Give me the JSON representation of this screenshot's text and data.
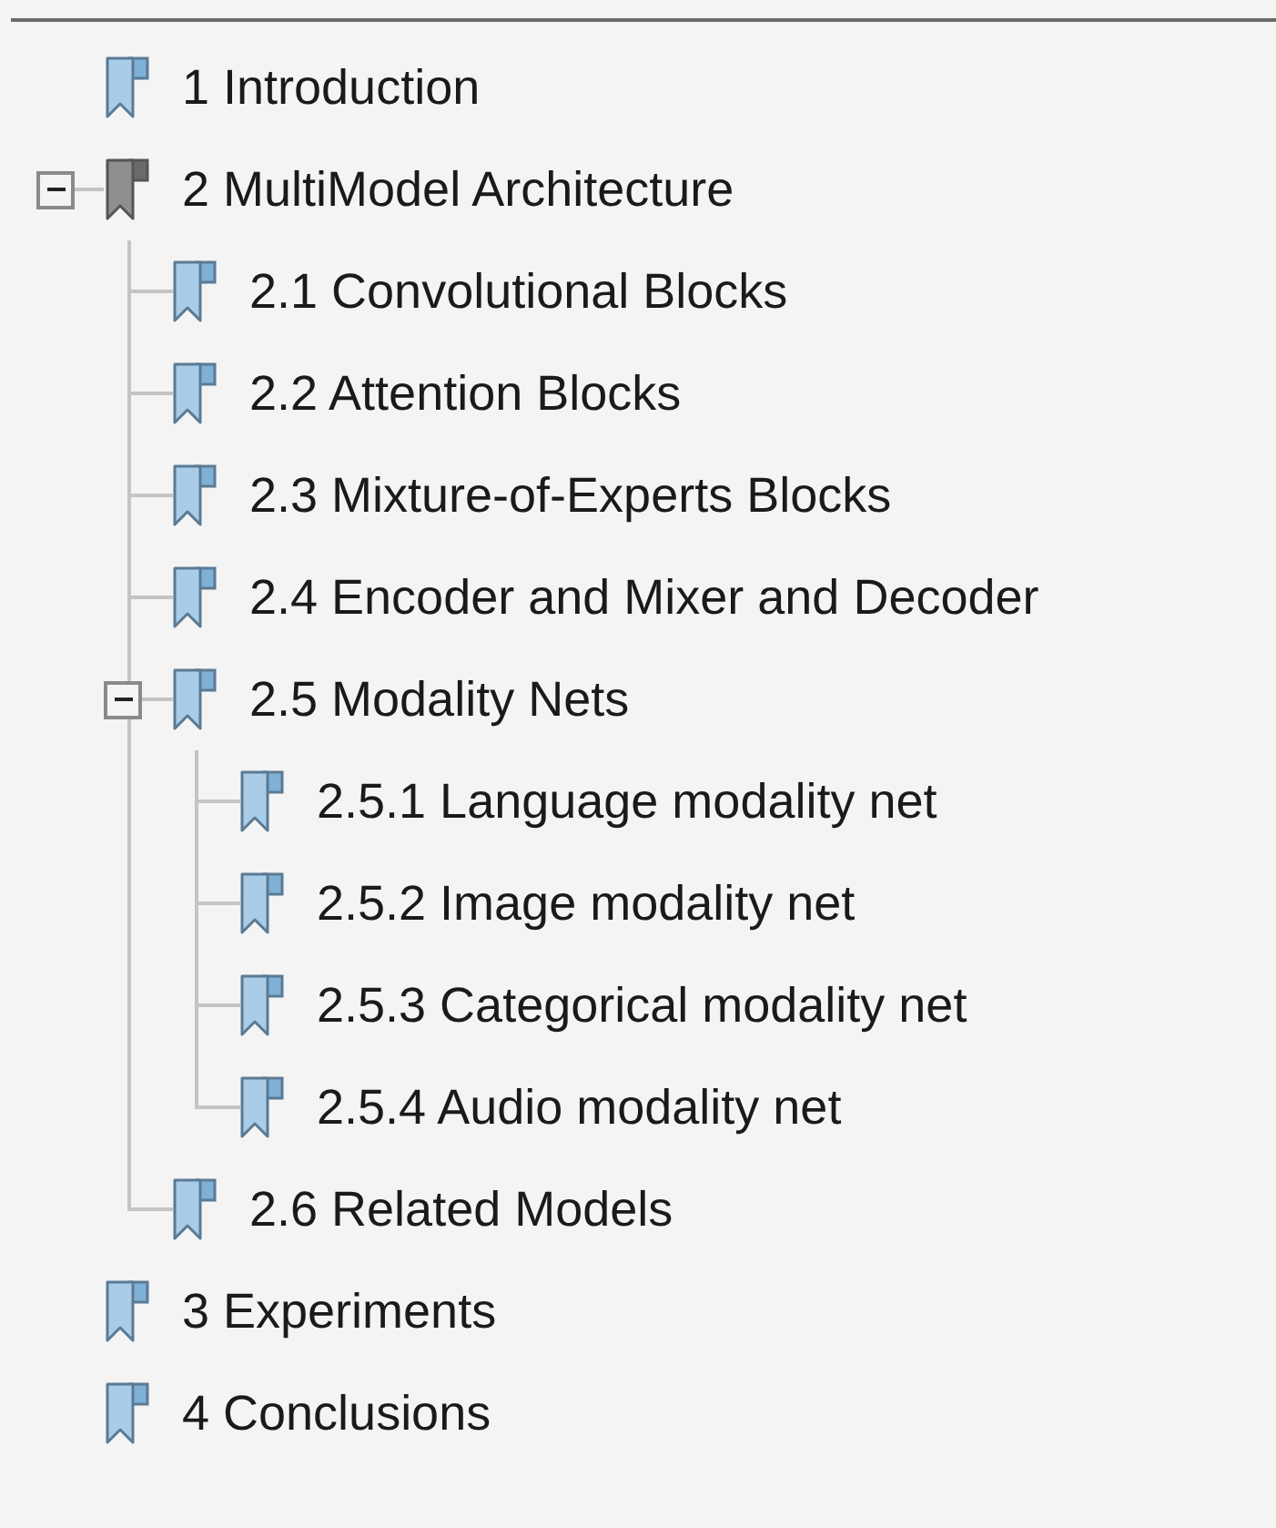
{
  "bookmarks": [
    {
      "label": "1 Introduction",
      "selected": false
    },
    {
      "label": "2 MultiModel Architecture",
      "selected": true,
      "expanded": true,
      "children": [
        {
          "label": "2.1 Convolutional Blocks",
          "selected": false
        },
        {
          "label": "2.2 Attention Blocks",
          "selected": false
        },
        {
          "label": "2.3 Mixture-of-Experts Blocks",
          "selected": false
        },
        {
          "label": "2.4 Encoder and Mixer and Decoder",
          "selected": false
        },
        {
          "label": "2.5 Modality Nets",
          "selected": false,
          "expanded": true,
          "children": [
            {
              "label": "2.5.1 Language modality net",
              "selected": false
            },
            {
              "label": "2.5.2 Image modality net",
              "selected": false
            },
            {
              "label": "2.5.3 Categorical modality net",
              "selected": false
            },
            {
              "label": "2.5.4 Audio modality net",
              "selected": false
            }
          ]
        },
        {
          "label": "2.6 Related Models",
          "selected": false
        }
      ]
    },
    {
      "label": "3 Experiments",
      "selected": false
    },
    {
      "label": "4 Conclusions",
      "selected": false
    }
  ]
}
